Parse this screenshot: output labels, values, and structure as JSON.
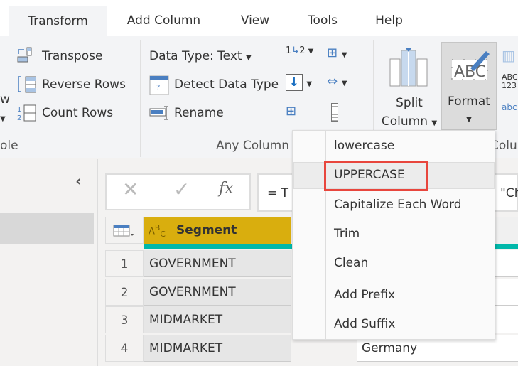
{
  "tabs": [
    {
      "label": "Transform",
      "active": true
    },
    {
      "label": "Add Column"
    },
    {
      "label": "View"
    },
    {
      "label": "Tools"
    },
    {
      "label": "Help"
    }
  ],
  "ribbon": {
    "partial_left": "w",
    "table_group": {
      "label": "ole",
      "items": [
        "Transpose",
        "Reverse Rows",
        "Count Rows"
      ]
    },
    "any_column_group": {
      "label": "Any Column",
      "data_type": "Data Type: Text",
      "detect": "Detect Data Type",
      "rename": "Rename"
    },
    "split_column": {
      "line1": "Split",
      "line2": "Column"
    },
    "format": {
      "label": "Format",
      "active": true
    },
    "right_group_label": "Colu",
    "caret": "▾"
  },
  "formula_bar": {
    "cancel": "✕",
    "confirm": "✓",
    "fx": "fx",
    "text_start": "=  T",
    "text_end": "\"Ch"
  },
  "grid": {
    "header": {
      "type_icon": "ABC",
      "column": "Segment",
      "header_color": "#d9ae0e",
      "quality_color": "#01b8aa"
    },
    "rows": [
      {
        "n": "1",
        "segment": "GOVERNMENT",
        "other": ""
      },
      {
        "n": "2",
        "segment": "GOVERNMENT",
        "other": ""
      },
      {
        "n": "3",
        "segment": "MIDMARKET",
        "other": ""
      },
      {
        "n": "4",
        "segment": "MIDMARKET",
        "other": "Germany"
      }
    ]
  },
  "format_menu": {
    "items": [
      "lowercase",
      "UPPERCASE",
      "Capitalize Each Word",
      "Trim",
      "Clean",
      "Add Prefix",
      "Add Suffix"
    ],
    "highlighted": "UPPERCASE",
    "highlight_color": "#e8463d"
  }
}
